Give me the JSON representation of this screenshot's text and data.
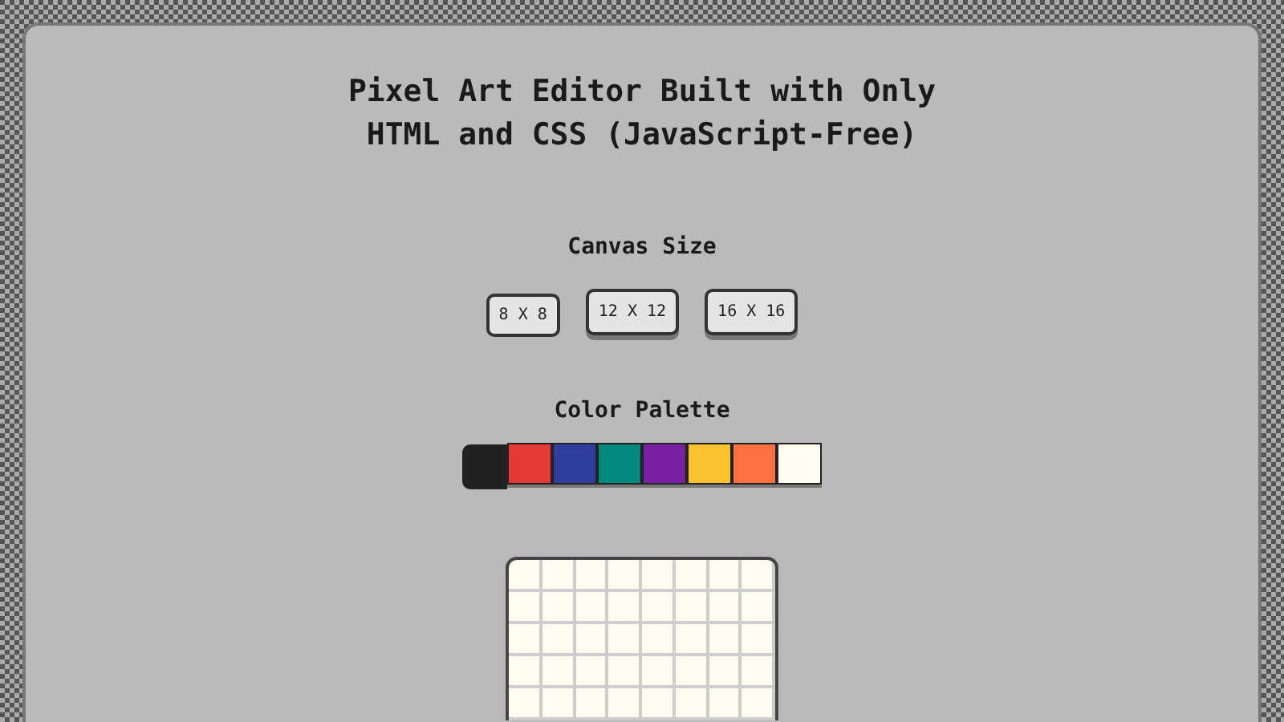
{
  "title": "Pixel Art Editor Built with Only HTML and CSS (JavaScript-Free)",
  "canvas_size": {
    "heading": "Canvas Size",
    "options": [
      {
        "label": "8 X 8",
        "selected": true
      },
      {
        "label": "12 X 12",
        "selected": false
      },
      {
        "label": "16 X 16",
        "selected": false
      }
    ]
  },
  "palette": {
    "heading": "Color Palette",
    "swatches": [
      {
        "color": "#212121",
        "selected": true
      },
      {
        "color": "#e53935",
        "selected": false
      },
      {
        "color": "#303f9f",
        "selected": false
      },
      {
        "color": "#00897b",
        "selected": false
      },
      {
        "color": "#7b1fa2",
        "selected": false
      },
      {
        "color": "#fbc02d",
        "selected": false
      },
      {
        "color": "#ff7043",
        "selected": false
      },
      {
        "color": "#fffdf0",
        "selected": false
      }
    ]
  }
}
